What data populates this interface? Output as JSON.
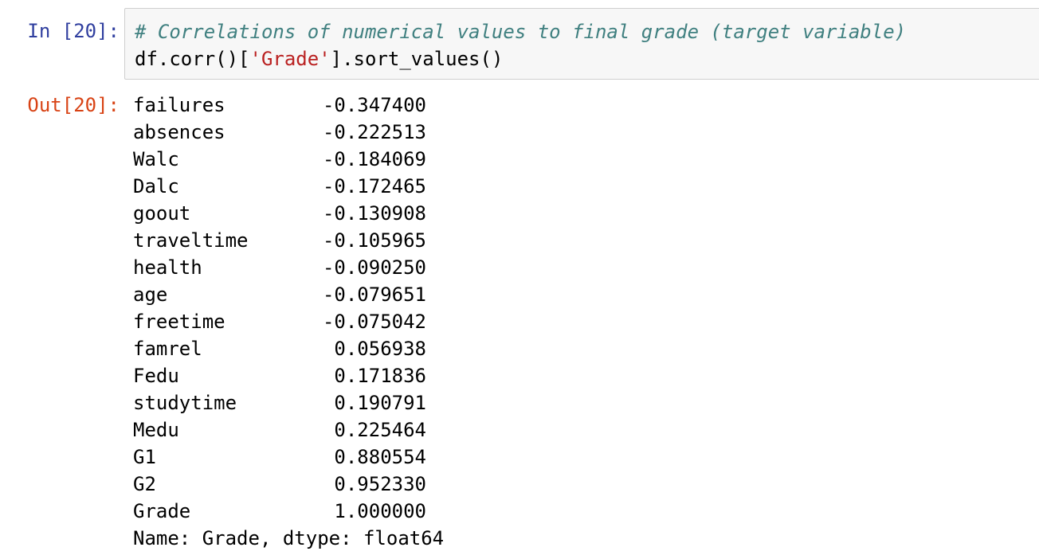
{
  "cell": {
    "in_prompt": "In [20]:",
    "out_prompt": "Out[20]:",
    "code_comment": "# Correlations of numerical values to final grade (target variable)",
    "code_pre": "df.corr()[",
    "code_string": "'Grade'",
    "code_post": "].sort_values()"
  },
  "output": {
    "rows": [
      {
        "name": "failures",
        "value": "-0.347400"
      },
      {
        "name": "absences",
        "value": "-0.222513"
      },
      {
        "name": "Walc",
        "value": "-0.184069"
      },
      {
        "name": "Dalc",
        "value": "-0.172465"
      },
      {
        "name": "goout",
        "value": "-0.130908"
      },
      {
        "name": "traveltime",
        "value": "-0.105965"
      },
      {
        "name": "health",
        "value": "-0.090250"
      },
      {
        "name": "age",
        "value": "-0.079651"
      },
      {
        "name": "freetime",
        "value": "-0.075042"
      },
      {
        "name": "famrel",
        "value": "0.056938"
      },
      {
        "name": "Fedu",
        "value": "0.171836"
      },
      {
        "name": "studytime",
        "value": "0.190791"
      },
      {
        "name": "Medu",
        "value": "0.225464"
      },
      {
        "name": "G1",
        "value": "0.880554"
      },
      {
        "name": "G2",
        "value": "0.952330"
      },
      {
        "name": "Grade",
        "value": "1.000000"
      }
    ],
    "footer": "Name: Grade, dtype: float64"
  },
  "colors": {
    "in_prompt": "#303F9F",
    "out_prompt": "#D84315",
    "comment": "#408080",
    "string": "#BA2121",
    "input_bg": "#f7f7f7"
  }
}
